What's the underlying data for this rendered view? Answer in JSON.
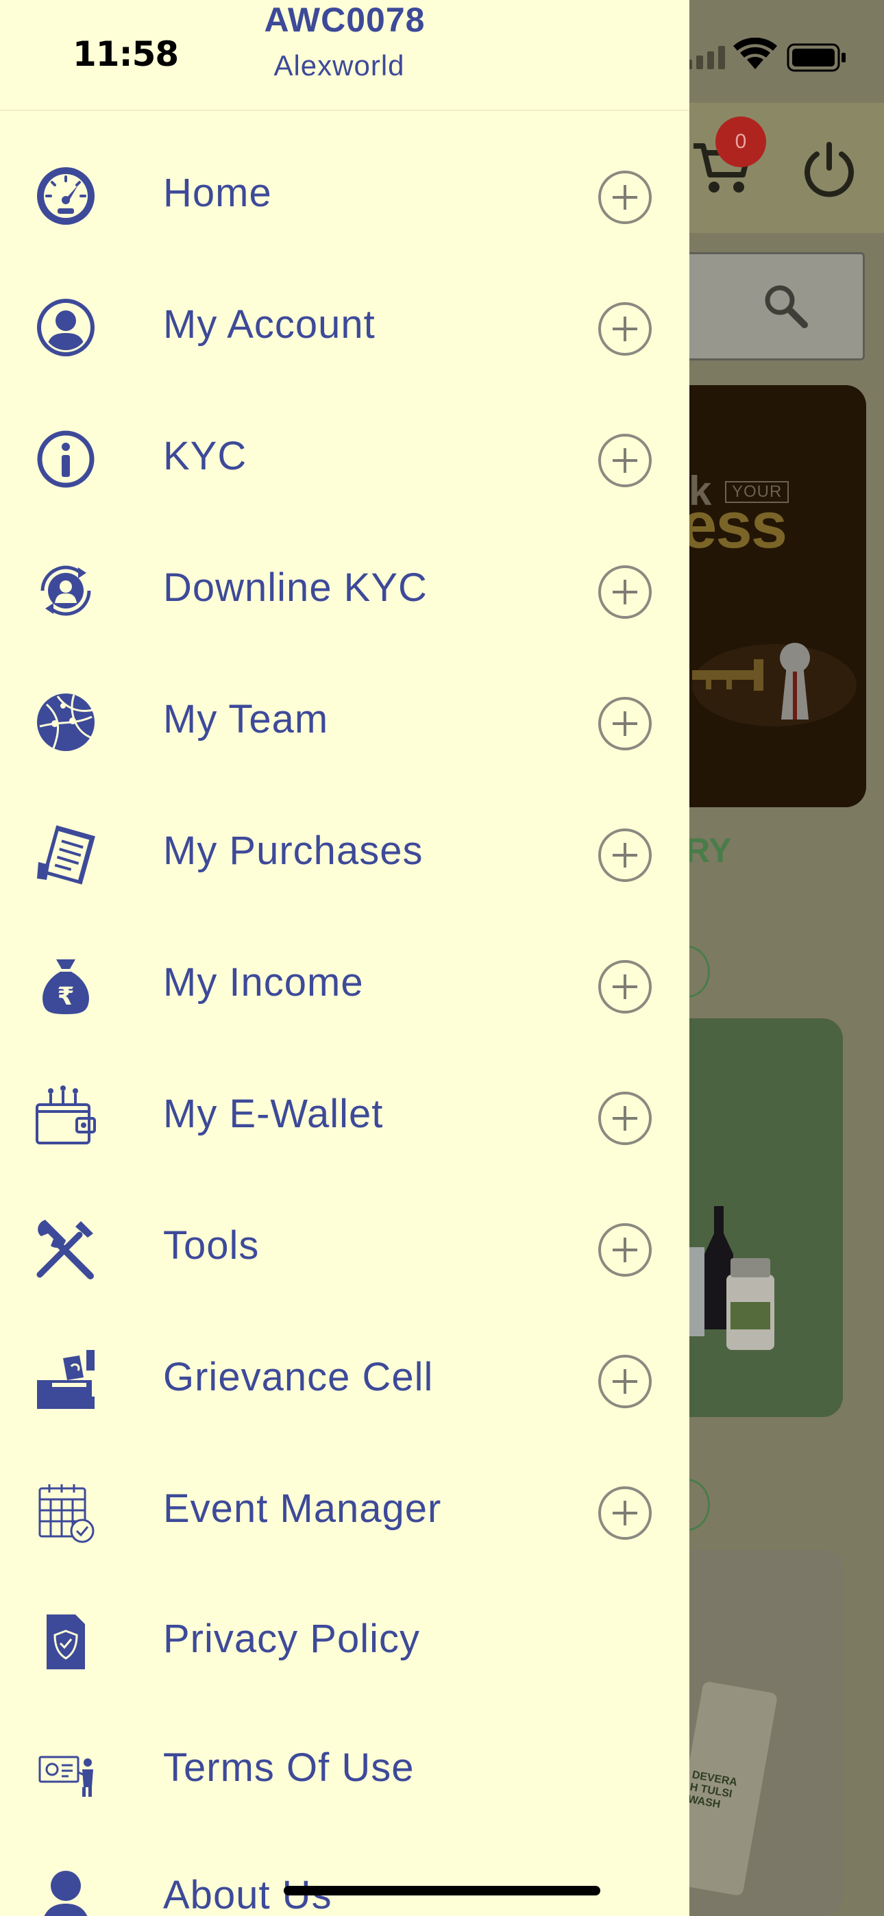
{
  "status_bar": {
    "time": "11:58"
  },
  "drawer": {
    "user_id": "AWC0078",
    "user_name": "Alexworld",
    "items": [
      {
        "label": "Home",
        "icon": "speedometer-icon",
        "expandable": true
      },
      {
        "label": "My Account",
        "icon": "user-circle-icon",
        "expandable": true
      },
      {
        "label": "KYC",
        "icon": "info-icon",
        "expandable": true
      },
      {
        "label": "Downline KYC",
        "icon": "user-refresh-icon",
        "expandable": true
      },
      {
        "label": "My Team",
        "icon": "globe-icon",
        "expandable": true
      },
      {
        "label": "My Purchases",
        "icon": "receipt-icon",
        "expandable": true
      },
      {
        "label": "My Income",
        "icon": "money-bag-icon",
        "expandable": true
      },
      {
        "label": "My E-Wallet",
        "icon": "wallet-icon",
        "expandable": true
      },
      {
        "label": "Tools",
        "icon": "tools-icon",
        "expandable": true
      },
      {
        "label": "Grievance Cell",
        "icon": "ballot-box-icon",
        "expandable": true
      },
      {
        "label": "Event Manager",
        "icon": "calendar-icon",
        "expandable": true
      },
      {
        "label": "Privacy Policy",
        "icon": "shield-document-icon",
        "expandable": false
      },
      {
        "label": "Terms Of Use",
        "icon": "terms-icon",
        "expandable": false
      },
      {
        "label": "About Us",
        "icon": "person-icon",
        "expandable": false
      }
    ]
  },
  "background": {
    "cart_count": "0",
    "banner_text_top": "k",
    "banner_badge": "YOUR",
    "banner_text_bottom": "ess",
    "category_fragment": "RY",
    "product_label_1": "DEVERA",
    "product_label_2": "H TULSI",
    "product_label_3": "WASH"
  },
  "colors": {
    "drawer_bg": "#fefed7",
    "accent": "#3d4a99",
    "badge": "#b0241f"
  }
}
